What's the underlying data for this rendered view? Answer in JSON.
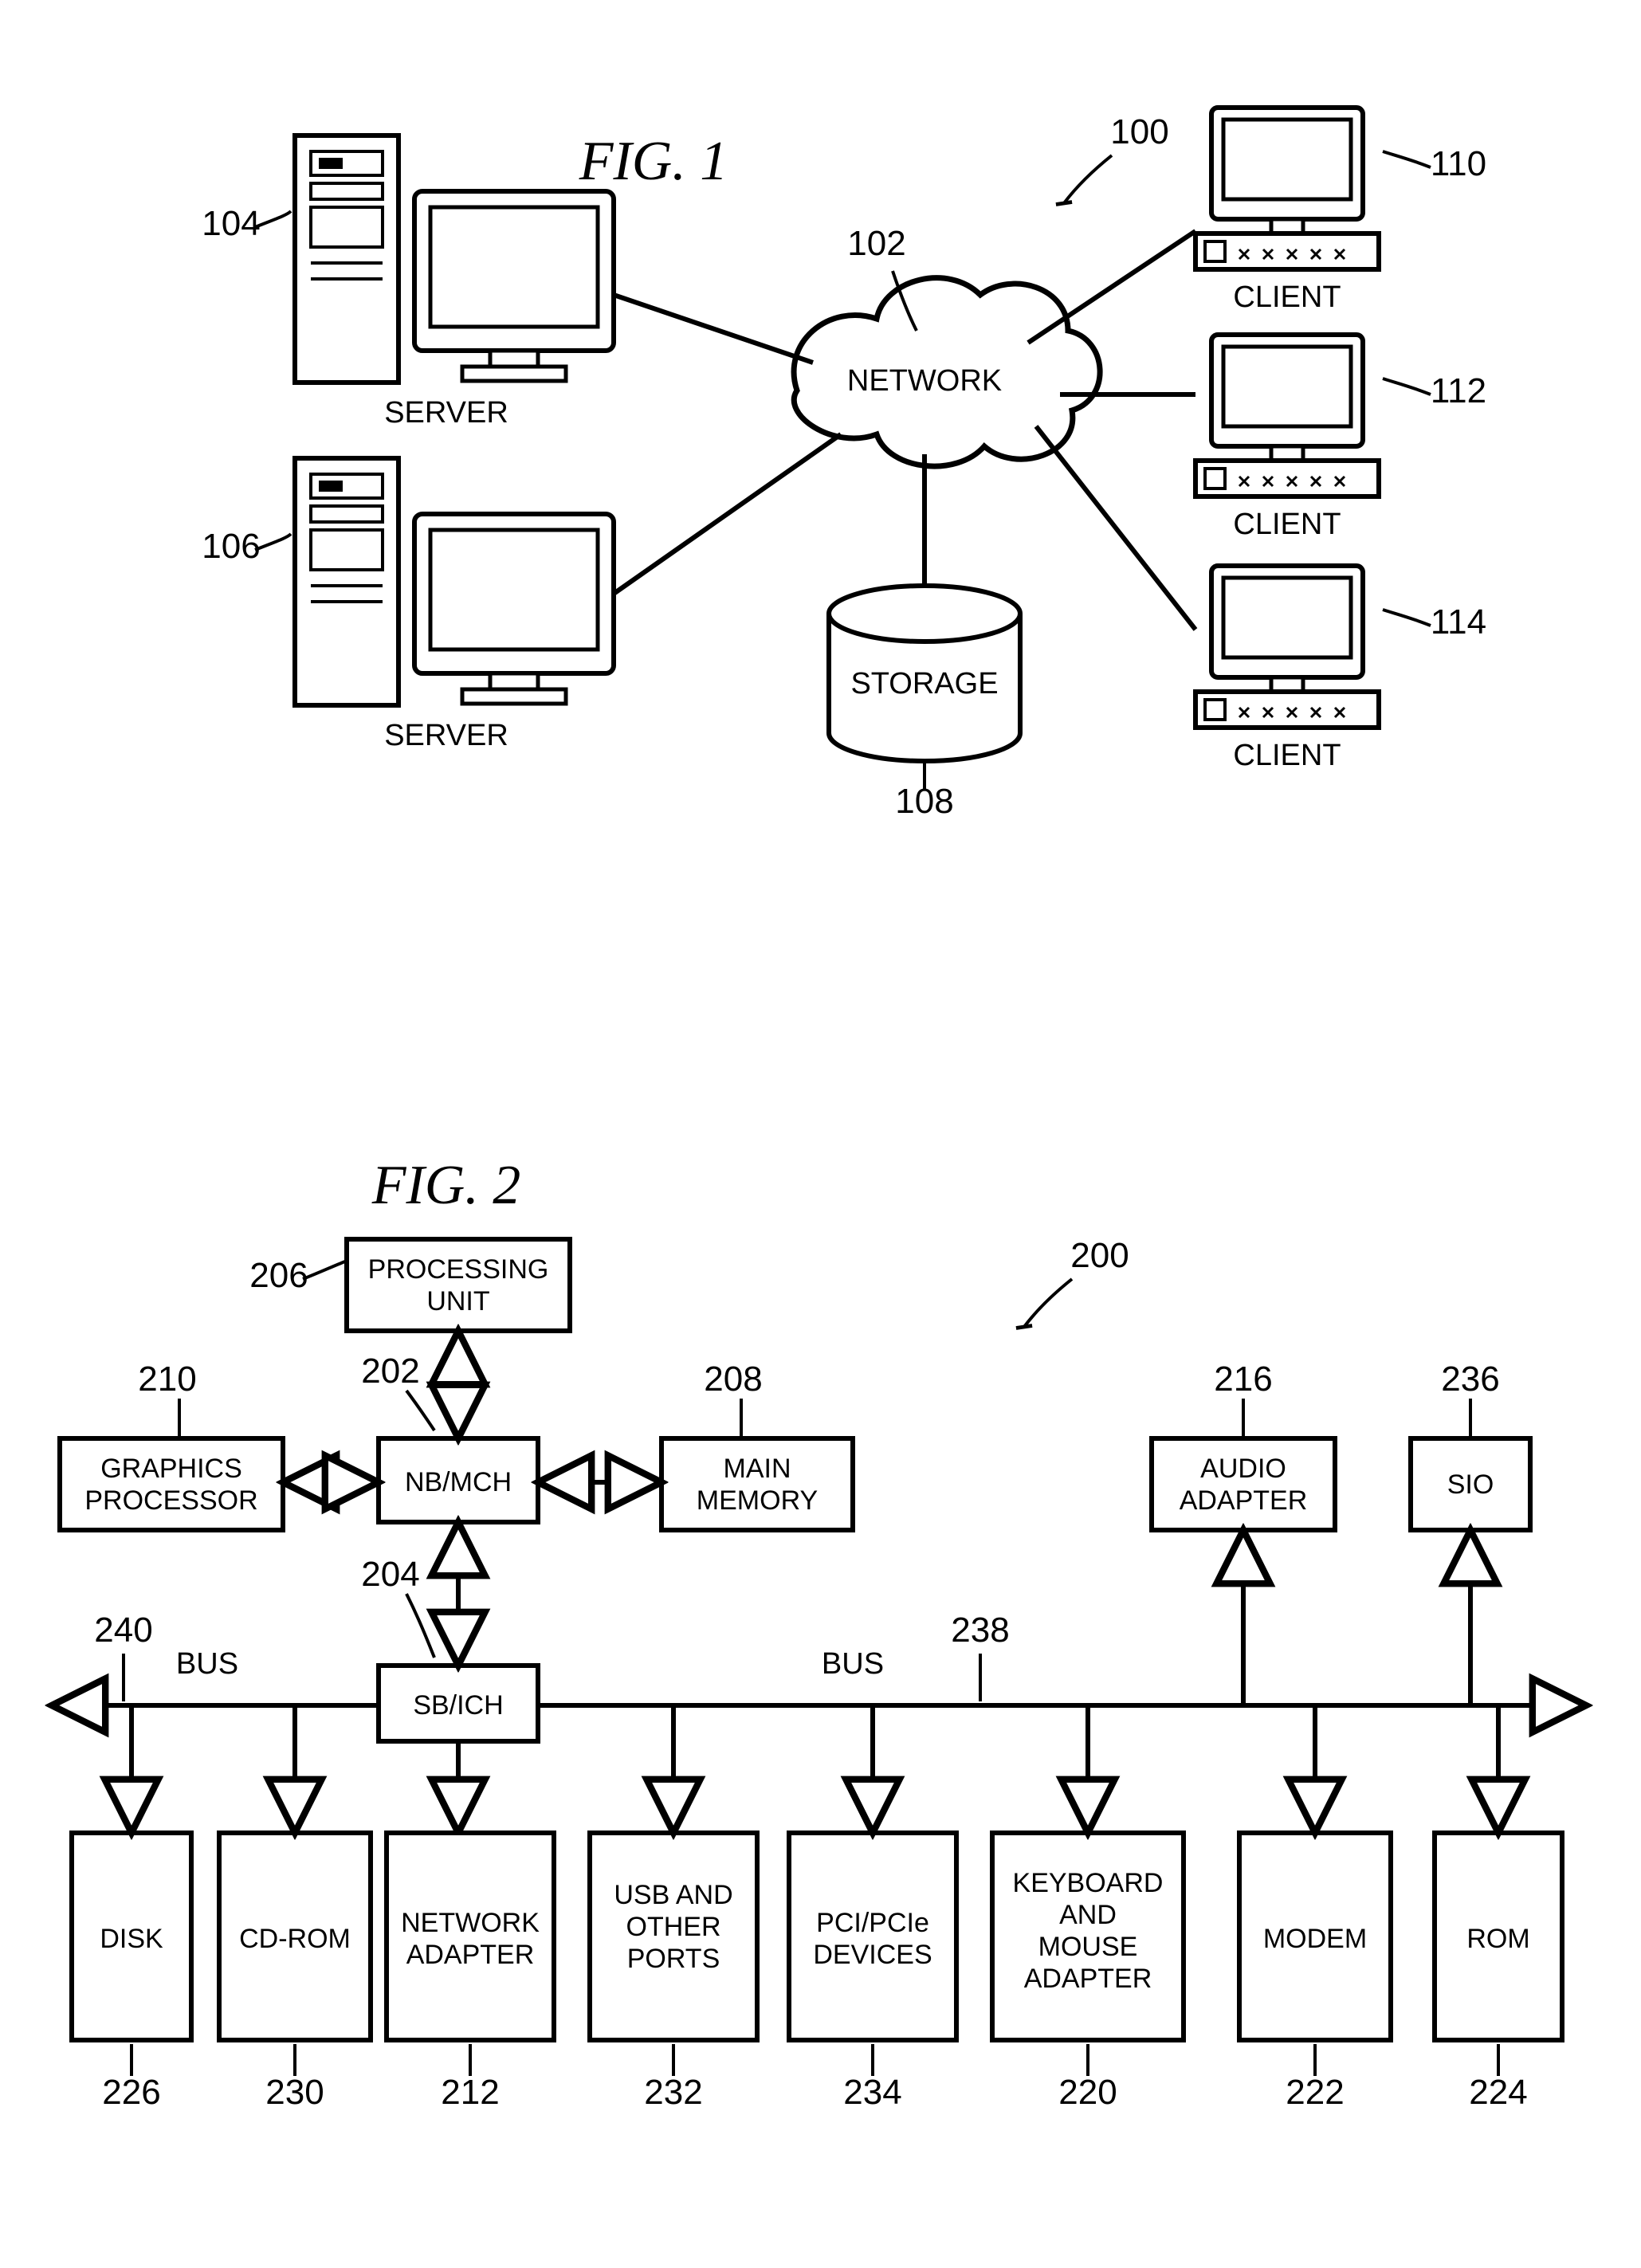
{
  "fig1": {
    "title": "FIG. 1",
    "refs": {
      "overall": "100",
      "network": "102",
      "server1": "104",
      "server2": "106",
      "storage": "108",
      "client1": "110",
      "client2": "112",
      "client3": "114"
    },
    "labels": {
      "server": "SERVER",
      "network": "NETWORK",
      "storage": "STORAGE",
      "client": "CLIENT"
    }
  },
  "fig2": {
    "title": "FIG. 2",
    "refs": {
      "overall": "200",
      "nbmch": "202",
      "sbich": "204",
      "procunit": "206",
      "mainmem": "208",
      "gfx": "210",
      "netadapter": "212",
      "audio": "216",
      "kbdmouse": "220",
      "modem": "222",
      "rom": "224",
      "disk": "226",
      "cdrom": "230",
      "usb": "232",
      "pci": "234",
      "sio": "236",
      "bus_right": "238",
      "bus_left": "240"
    },
    "labels": {
      "procunit": "PROCESSING UNIT",
      "gfx": "GRAPHICS PROCESSOR",
      "nbmch": "NB/MCH",
      "mainmem": "MAIN MEMORY",
      "sbich": "SB/ICH",
      "audio": "AUDIO ADAPTER",
      "sio": "SIO",
      "disk": "DISK",
      "cdrom": "CD-ROM",
      "netadapter": "NETWORK ADAPTER",
      "usb": "USB AND OTHER PORTS",
      "pci": "PCI/PCIe DEVICES",
      "kbdmouse": "KEYBOARD AND MOUSE ADAPTER",
      "modem": "MODEM",
      "rom": "ROM",
      "bus": "BUS"
    }
  }
}
